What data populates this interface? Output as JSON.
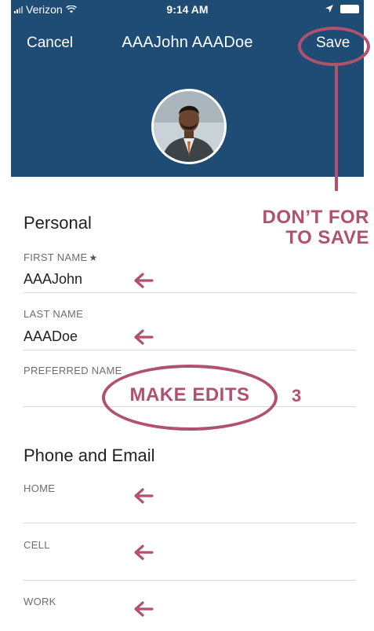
{
  "status_bar": {
    "carrier": "Verizon",
    "time": "9:14 AM"
  },
  "nav": {
    "cancel_label": "Cancel",
    "title": "AAAJohn AAADoe",
    "save_label": "Save"
  },
  "annotations": {
    "save_reminder_line1": "DON’T FOR",
    "save_reminder_line2": "TO SAVE",
    "make_edits": "MAKE EDITS",
    "step": "3",
    "color": "#b2516e"
  },
  "personal": {
    "title": "Personal",
    "first_name_label": "FIRST NAME",
    "first_name_value": "AAAJohn",
    "last_name_label": "LAST NAME",
    "last_name_value": "AAADoe",
    "preferred_name_label": "PREFERRED NAME",
    "preferred_name_value": ""
  },
  "phone_email": {
    "title": "Phone and Email",
    "home_label": "HOME",
    "home_value": "",
    "cell_label": "CELL",
    "cell_value": "",
    "work_label": "WORK",
    "work_value": ""
  },
  "colors": {
    "header_bg": "#1f4c75",
    "annotation": "#b2516e"
  }
}
